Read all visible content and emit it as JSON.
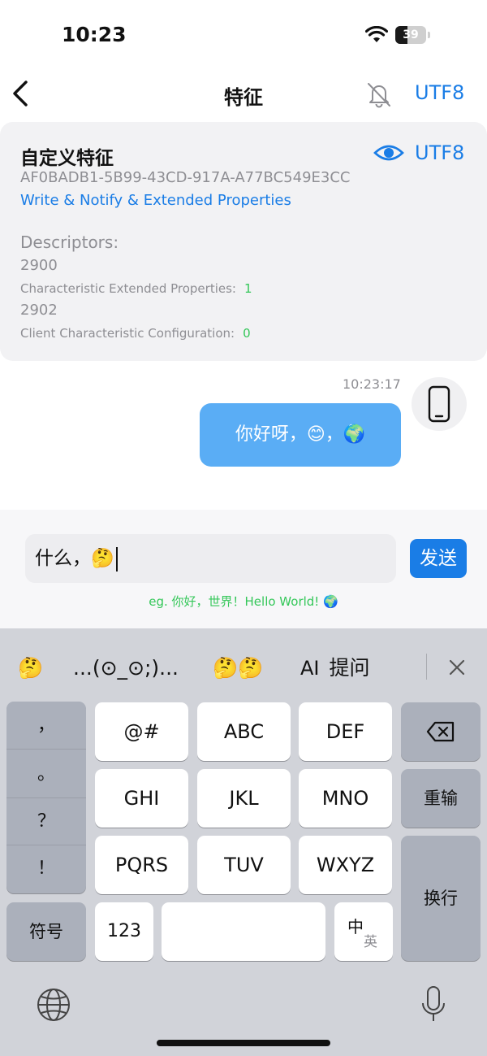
{
  "status_bar": {
    "time": "10:23",
    "battery": "39",
    "battery_level": 0.39
  },
  "nav": {
    "title": "特征",
    "encoding": "UTF8"
  },
  "characteristic": {
    "name": "自定义特征",
    "encoding": "UTF8",
    "uuid": "AF0BADB1-5B99-43CD-917A-A77BC549E3CC",
    "properties": "Write & Notify & Extended Properties",
    "descriptors_title": "Descriptors:",
    "descriptors": [
      {
        "uuid": "2900",
        "name": "Characteristic Extended Properties:",
        "value": "1"
      },
      {
        "uuid": "2902",
        "name": "Client Characteristic Configuration:",
        "value": "0"
      }
    ]
  },
  "messages": [
    {
      "time": "10:23:17",
      "text": "你好呀，😊，🌍"
    }
  ],
  "input": {
    "value": "什么，🤔",
    "send_label": "发送",
    "hint": "eg. 你好，世界！Hello World! 🌍"
  },
  "keyboard": {
    "candidates": [
      "🤔",
      "...(⊙_⊙;)...",
      "🤔🤔",
      "提问"
    ],
    "ai_label": "AI",
    "punctuation": [
      "，",
      "。",
      "？",
      "！"
    ],
    "keys": {
      "at": "@#",
      "abc": "ABC",
      "def": "DEF",
      "ghi": "GHI",
      "jkl": "JKL",
      "mno": "MNO",
      "pqrs": "PQRS",
      "tuv": "TUV",
      "wxyz": "WXYZ",
      "reinput": "重输",
      "newline": "换行",
      "symbols": "符号",
      "numbers": "123",
      "lang_zh": "中",
      "lang_en": "英"
    }
  }
}
